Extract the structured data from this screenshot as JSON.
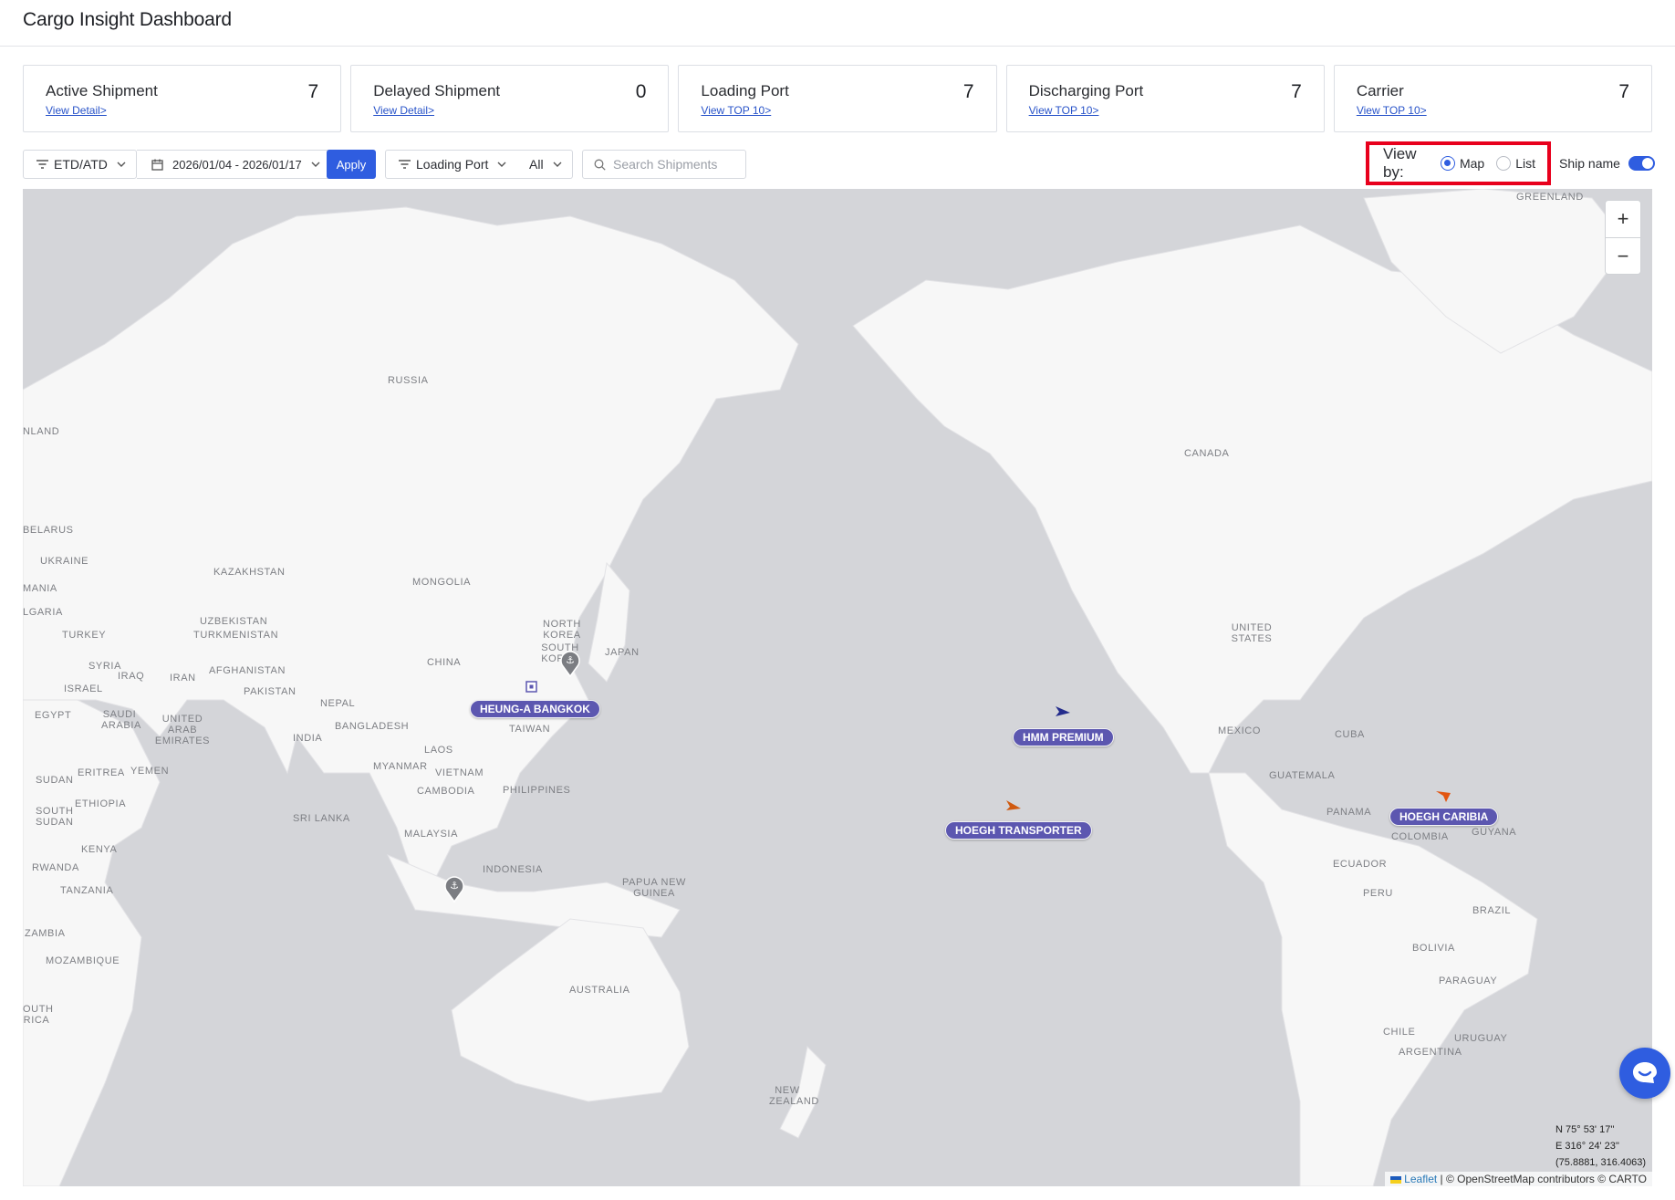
{
  "header": {
    "title": "Cargo Insight Dashboard"
  },
  "cards": [
    {
      "title": "Active Shipment",
      "link": "View Detail>",
      "value": "7"
    },
    {
      "title": "Delayed Shipment",
      "link": "View Detail>",
      "value": "0"
    },
    {
      "title": "Loading Port",
      "link": "View TOP 10>",
      "value": "7"
    },
    {
      "title": "Discharging Port",
      "link": "View TOP 10>",
      "value": "7"
    },
    {
      "title": "Carrier",
      "link": "View TOP 10>",
      "value": "7"
    }
  ],
  "filters": {
    "date_type": "ETD/ATD",
    "date_range": "2026/01/04 - 2026/01/17",
    "apply_label": "Apply",
    "port_type": "Loading Port",
    "port_value": "All",
    "search_placeholder": "Search Shipments"
  },
  "view_by": {
    "label": "View by:",
    "options": [
      "Map",
      "List"
    ],
    "selected": "Map"
  },
  "ship_name_toggle": {
    "label": "Ship name",
    "on": true
  },
  "map": {
    "country_labels": [
      "GREENLAND",
      "RUSSIA",
      "CANADA",
      "NLAND",
      "BELARUS",
      "UKRAINE",
      "KAZAKHSTAN",
      "MONGOLIA",
      "MANIA",
      "LGARIA",
      "UZBEKISTAN",
      "TURKMENISTAN",
      "TURKEY",
      "NORTH KOREA",
      "SOUTH KOREA",
      "JAPAN",
      "UNITED STATES",
      "SYRIA",
      "IRAQ",
      "IRAN",
      "AFGHANISTAN",
      "ISRAEL",
      "CHINA",
      "PAKISTAN",
      "EGYPT",
      "SAUDI ARABIA",
      "UNITED ARAB EMIRATES",
      "NEPAL",
      "BANGLADESH",
      "INDIA",
      "TAIWAN",
      "MEXICO",
      "CUBA",
      "LAOS",
      "MYANMAR",
      "VIETNAM",
      "GUATEMALA",
      "SUDAN",
      "ERITREA",
      "YEMEN",
      "CAMBODIA",
      "PHILIPPINES",
      "SOUTH SUDAN",
      "ETHIOPIA",
      "SRI LANKA",
      "PANAMA",
      "GUYANA",
      "COLOMBIA",
      "MALAYSIA",
      "KENYA",
      "RWANDA",
      "INDONESIA",
      "ECUADOR",
      "PAPUA NEW GUINEA",
      "TANZANIA",
      "PERU",
      "BRAZIL",
      "ZAMBIA",
      "BOLIVIA",
      "MOZAMBIQUE",
      "PARAGUAY",
      "AUSTRALIA",
      "OUTH RICA",
      "CHILE",
      "URUGUAY",
      "ARGENTINA",
      "NEW ZEALAND"
    ],
    "ships": [
      {
        "name": "HEUNG-A BANGKOK"
      },
      {
        "name": "HMM PREMIUM"
      },
      {
        "name": "HOEGH TRANSPORTER"
      },
      {
        "name": "HOEGH CARIBIA"
      }
    ],
    "coords": [
      "N 75° 53' 17''",
      "E 316° 24' 23''",
      "(75.8881, 316.4063)"
    ],
    "attribution_leaflet": "Leaflet",
    "attribution_rest": "| © OpenStreetMap contributors © CARTO"
  },
  "colors": {
    "accent": "#2f5de0",
    "ship_label": "#5c57b0",
    "highlight": "#e8001c",
    "ocean": "#d4d5d9",
    "land": "#f7f7f7"
  }
}
